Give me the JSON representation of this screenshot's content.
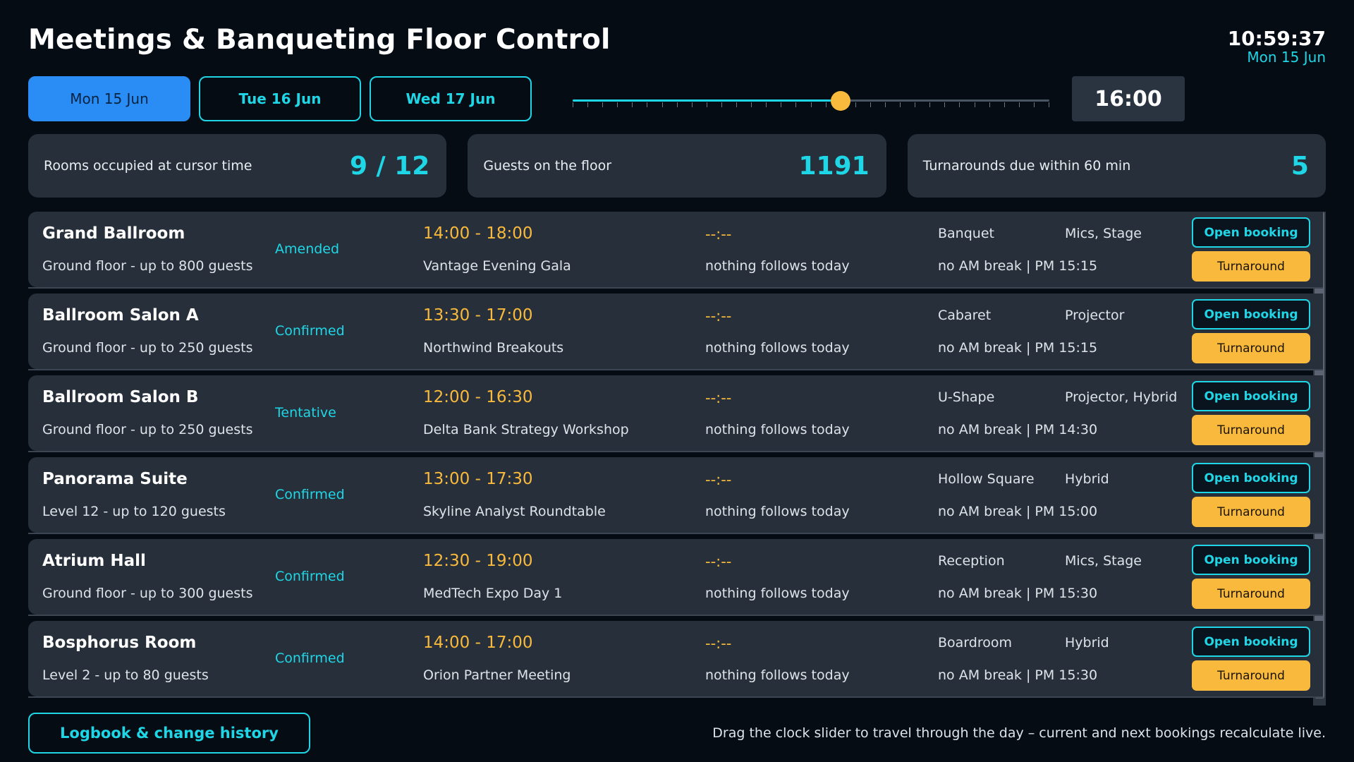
{
  "header": {
    "title": "Meetings & Banqueting Floor Control",
    "clock_time": "10:59:37",
    "clock_date": "Mon 15 Jun"
  },
  "day_tabs": [
    {
      "label": "Mon 15 Jun",
      "active": true
    },
    {
      "label": "Tue 16 Jun",
      "active": false
    },
    {
      "label": "Wed 17 Jun",
      "active": false
    }
  ],
  "time_slider": {
    "value_fraction": 0.562,
    "tick_count": 33,
    "cursor_time": "16:00"
  },
  "stats": [
    {
      "label": "Rooms occupied at cursor time",
      "value": "9 / 12"
    },
    {
      "label": "Guests on the floor",
      "value": "1191"
    },
    {
      "label": "Turnarounds due within 60 min",
      "value": "5"
    }
  ],
  "rooms": [
    {
      "name": "Grand Ballroom",
      "location": "Ground floor  -  up to 800 guests",
      "status": "Amended",
      "time": "14:00 - 18:00",
      "event": "Vantage Evening Gala",
      "next_time": "--:--",
      "next_label": "nothing follows today",
      "setup": "Banquet",
      "av": "Mics, Stage",
      "breaks": "no AM break  |  PM 15:15",
      "open_label": "Open booking",
      "turn_label": "Turnaround"
    },
    {
      "name": "Ballroom Salon A",
      "location": "Ground floor  -  up to 250 guests",
      "status": "Confirmed",
      "time": "13:30 - 17:00",
      "event": "Northwind Breakouts",
      "next_time": "--:--",
      "next_label": "nothing follows today",
      "setup": "Cabaret",
      "av": "Projector",
      "breaks": "no AM break  |  PM 15:15",
      "open_label": "Open booking",
      "turn_label": "Turnaround"
    },
    {
      "name": "Ballroom Salon B",
      "location": "Ground floor  -  up to 250 guests",
      "status": "Tentative",
      "time": "12:00 - 16:30",
      "event": "Delta Bank Strategy Workshop",
      "next_time": "--:--",
      "next_label": "nothing follows today",
      "setup": "U-Shape",
      "av": "Projector, Hybrid",
      "breaks": "no AM break  |  PM 14:30",
      "open_label": "Open booking",
      "turn_label": "Turnaround"
    },
    {
      "name": "Panorama Suite",
      "location": "Level 12  -  up to 120 guests",
      "status": "Confirmed",
      "time": "13:00 - 17:30",
      "event": "Skyline Analyst Roundtable",
      "next_time": "--:--",
      "next_label": "nothing follows today",
      "setup": "Hollow Square",
      "av": "Hybrid",
      "breaks": "no AM break  |  PM 15:00",
      "open_label": "Open booking",
      "turn_label": "Turnaround"
    },
    {
      "name": "Atrium Hall",
      "location": "Ground floor  -  up to 300 guests",
      "status": "Confirmed",
      "time": "12:30 - 19:00",
      "event": "MedTech Expo Day 1",
      "next_time": "--:--",
      "next_label": "nothing follows today",
      "setup": "Reception",
      "av": "Mics, Stage",
      "breaks": "no AM break  |  PM 15:30",
      "open_label": "Open booking",
      "turn_label": "Turnaround"
    },
    {
      "name": "Bosphorus Room",
      "location": "Level 2  -  up to 80 guests",
      "status": "Confirmed",
      "time": "14:00 - 17:00",
      "event": "Orion Partner Meeting",
      "next_time": "--:--",
      "next_label": "nothing follows today",
      "setup": "Boardroom",
      "av": "Hybrid",
      "breaks": "no AM break  |  PM 15:30",
      "open_label": "Open booking",
      "turn_label": "Turnaround"
    }
  ],
  "footer": {
    "logbook_label": "Logbook & change history",
    "hint": "Drag the clock slider to travel through the day – current and next bookings recalculate live."
  },
  "colors": {
    "accent": "#1fd6e6",
    "active_tab": "#2a8cf5",
    "amber": "#f8b93c",
    "panel": "#27303a",
    "background": "#050c14"
  }
}
